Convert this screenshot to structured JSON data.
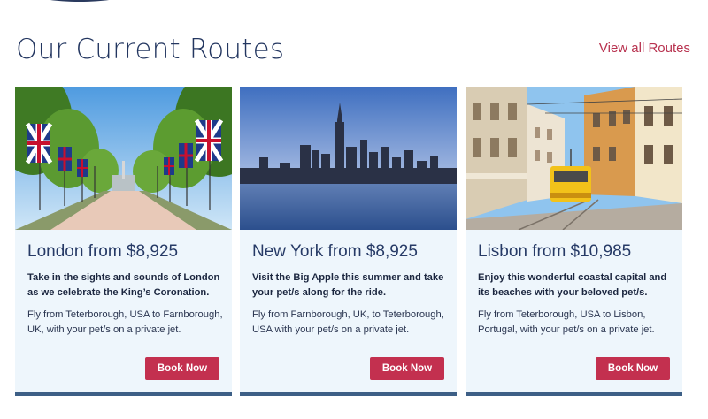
{
  "section": {
    "title": "Our Current Routes",
    "view_all_label": "View all Routes"
  },
  "colors": {
    "title": "#233660",
    "accent": "#c3304f",
    "card_background": "#eef6fc",
    "card_border": "#3d5f86"
  },
  "routes": [
    {
      "title": "London from $8,925",
      "lead": "Take in the sights and sounds of London as we celebrate the King’s Coronation.",
      "description": "Fly from Teterborough, USA to Farnborough, UK, with your pet/s on a private jet.",
      "button_label": "Book Now",
      "image_subject": "the-mall-union-jack-flags"
    },
    {
      "title": "New York from $8,925",
      "lead": "Visit the Big Apple this summer and take your pet/s along for the ride.",
      "description": "Fly from Farnborough, UK, to Teterborough, USA with your pet/s on a private jet.",
      "button_label": "Book Now",
      "image_subject": "manhattan-skyline-at-dusk"
    },
    {
      "title": "Lisbon from $10,985",
      "lead": "Enjoy this wonderful coastal capital and its beaches with your beloved pet/s.",
      "description": "Fly from Teterborough, USA to Lisbon, Portugal, with your pet/s on a private jet.",
      "button_label": "Book Now",
      "image_subject": "yellow-tram-street"
    }
  ]
}
